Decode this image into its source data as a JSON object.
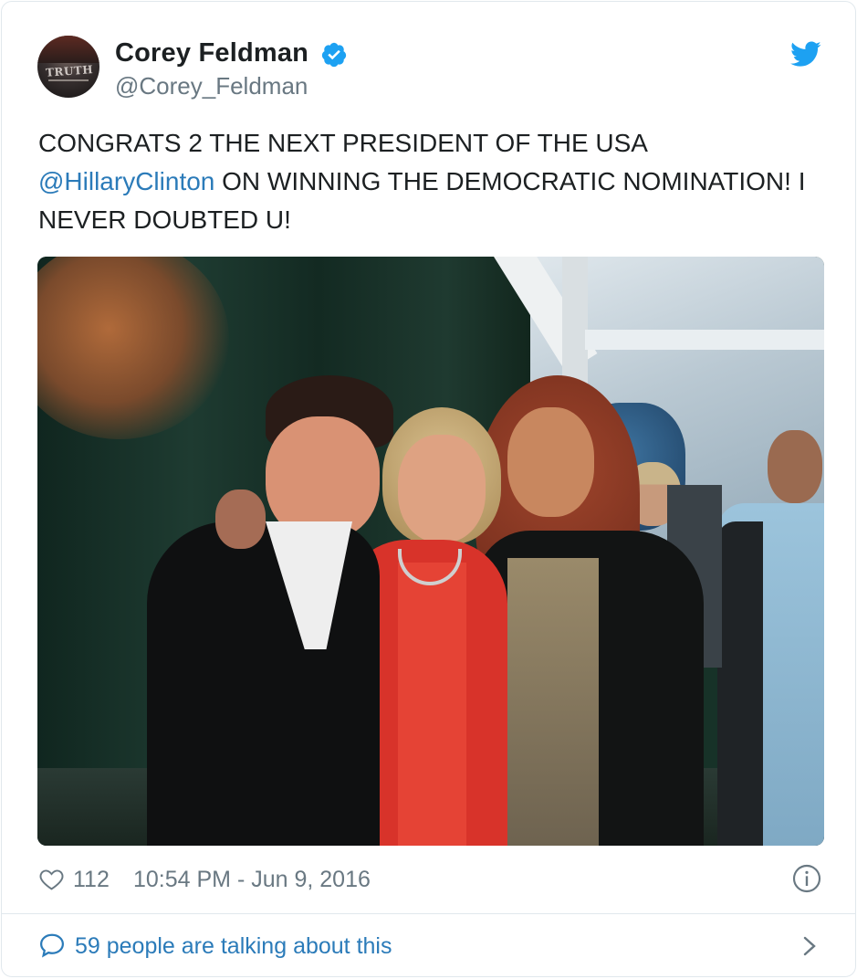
{
  "author": {
    "name": "Corey Feldman",
    "handle": "@Corey_Feldman",
    "avatar_text": "TRUTH",
    "verified": true
  },
  "tweet": {
    "text_line1": "CONGRATS 2 THE NEXT PRESIDENT OF THE USA",
    "mention": "@HillaryClinton",
    "text_after_mention": " ON WINNING THE DEMOCRATIC NOMINATION! I NEVER DOUBTED U!"
  },
  "stats": {
    "likes": "112",
    "timestamp": "10:54 PM - Jun 9, 2016"
  },
  "footer": {
    "talking_label": "59 people are talking about this"
  },
  "icons": {
    "brand": "twitter-bird-icon",
    "verified": "verified-badge-icon",
    "like": "heart-icon",
    "info": "info-icon",
    "comment": "speech-bubble-icon",
    "more": "chevron-right-icon"
  },
  "colors": {
    "brand_blue": "#1da1f2",
    "link_blue": "#2b7bb9",
    "muted_text": "#697882",
    "text": "#1c2022",
    "border": "#e1e8ed"
  }
}
